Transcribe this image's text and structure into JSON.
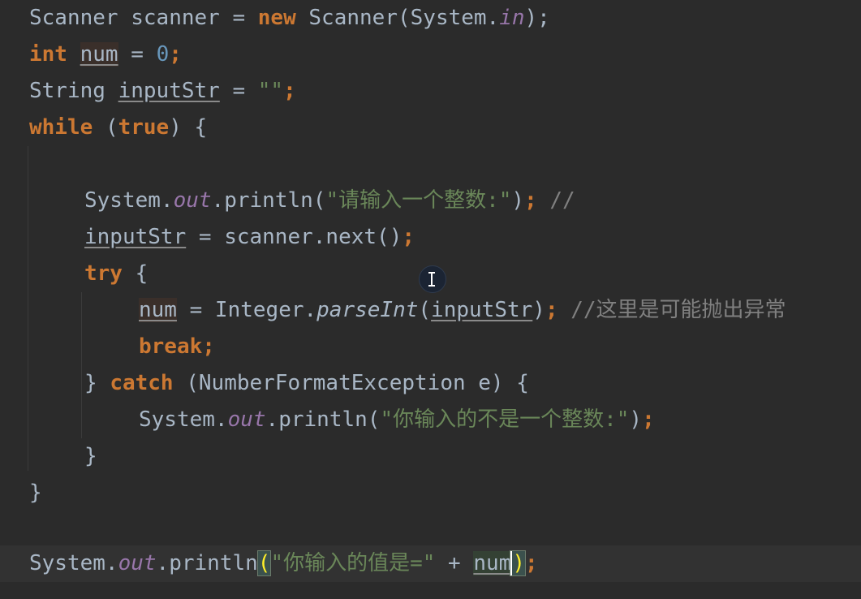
{
  "code": {
    "l1": {
      "type": "Scanner",
      "var": "scanner",
      "op": "=",
      "kw_new": "new",
      "ctor": "Scanner(System.",
      "field": "in",
      "end": ");"
    },
    "l2": {
      "kw": "int",
      "var": "num",
      "op": "=",
      "value": "0",
      "end": ";"
    },
    "l3": {
      "type": "String",
      "var": "inputStr",
      "op": "=",
      "value": "\"\"",
      "end": ";"
    },
    "l4": {
      "kw": "while",
      "open": "(",
      "kw_true": "true",
      "close": ") {"
    },
    "l6": {
      "obj": "System.",
      "field": "out",
      "call": ".println(",
      "str": "\"请输入一个整数:\"",
      "close": ")",
      "semi": ";",
      "comment": "//"
    },
    "l7": {
      "var": "inputStr",
      "rest": " = scanner.next()",
      "semi": ";"
    },
    "l8": {
      "kw": "try",
      "brace": " {"
    },
    "l9": {
      "var": "num",
      "op": " = Integer.",
      "method": "parseInt",
      "open": "(",
      "arg": "inputStr",
      "close": ")",
      "semi": ";",
      "comment": "//这里是可能抛出异常"
    },
    "l10": {
      "kw": "break",
      "semi": ";"
    },
    "l11": {
      "brace": "} ",
      "kw": "catch",
      "rest": " (NumberFormatException e) {"
    },
    "l12": {
      "obj": "System.",
      "field": "out",
      "call": ".println(",
      "str": "\"你输入的不是一个整数:\"",
      "close": ")",
      "semi": ";"
    },
    "l13": {
      "brace": "}"
    },
    "l14": {
      "brace": "}"
    },
    "l16": {
      "obj": "System.",
      "field": "out",
      "call": ".println",
      "open": "(",
      "str": "\"你输入的值是=\"",
      "plus": " + ",
      "var": "num",
      "close": ")",
      "semi": ";"
    }
  },
  "colors": {
    "background": "#2b2b2b",
    "keyword": "#cc7832",
    "string": "#6a8759",
    "number": "#6897bb",
    "field": "#9876aa",
    "default": "#a9b7c6",
    "comment": "#808080"
  },
  "icons": {
    "mouse_cursor": "text-cursor-icon"
  }
}
